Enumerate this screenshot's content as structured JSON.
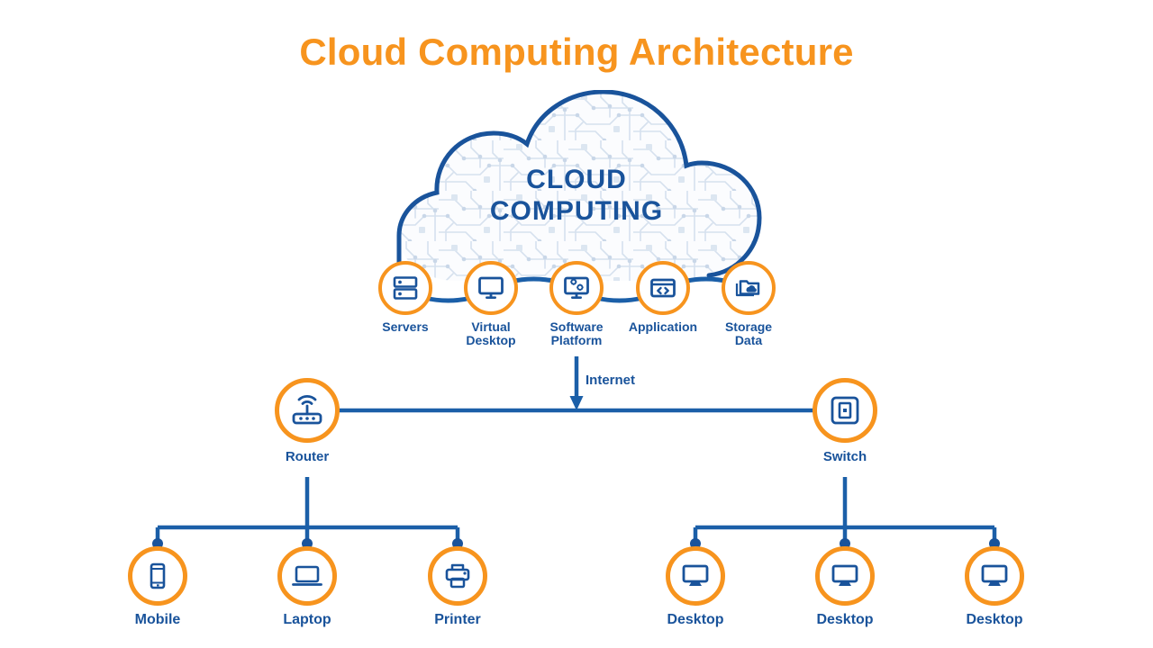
{
  "page": {
    "title": "Cloud Computing Architecture",
    "background": "#FFFFFF"
  },
  "colors": {
    "accent_orange": "#F7941E",
    "brand_blue": "#19539B",
    "line_blue": "#1B5FA8",
    "circuit_pattern": "#D9E3EE"
  },
  "cloud": {
    "label_line1": "CLOUD",
    "label_line2": "COMPUTING",
    "pattern_name": "circuit-board-pattern"
  },
  "cloud_services": [
    {
      "label": "Servers",
      "icon": "server-rack-icon"
    },
    {
      "label": "Virtual\nDesktop",
      "icon": "monitor-icon"
    },
    {
      "label": "Software\nPlatform",
      "icon": "monitor-gears-icon"
    },
    {
      "label": "Application",
      "icon": "code-window-icon"
    },
    {
      "label": "Storage\nData",
      "icon": "folder-cloud-icon"
    }
  ],
  "internet": {
    "label": "Internet",
    "arrow": "arrow-down-icon"
  },
  "network": [
    {
      "label": "Router",
      "icon": "router-icon"
    },
    {
      "label": "Switch",
      "icon": "switch-icon"
    }
  ],
  "devices_left": [
    {
      "label": "Mobile",
      "icon": "smartphone-icon"
    },
    {
      "label": "Laptop",
      "icon": "laptop-icon"
    },
    {
      "label": "Printer",
      "icon": "printer-icon"
    }
  ],
  "devices_right": [
    {
      "label": "Desktop",
      "icon": "desktop-monitor-icon"
    },
    {
      "label": "Desktop",
      "icon": "desktop-monitor-icon"
    },
    {
      "label": "Desktop",
      "icon": "desktop-monitor-icon"
    }
  ]
}
